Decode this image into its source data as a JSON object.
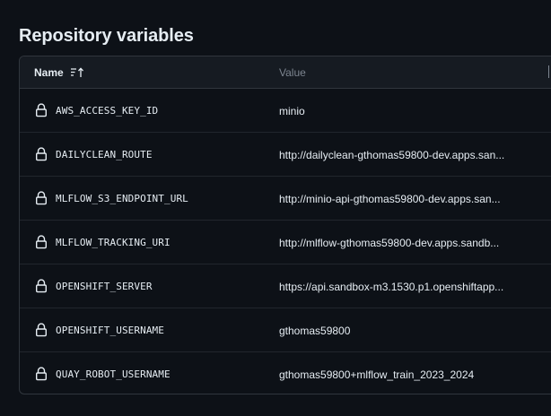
{
  "section": {
    "title": "Repository variables"
  },
  "table": {
    "columns": {
      "name": "Name",
      "value": "Value"
    },
    "sort_icon": "sort-ascending-icon",
    "row_icon": "lock-icon",
    "rows": [
      {
        "name": "AWS_ACCESS_KEY_ID",
        "value": "minio"
      },
      {
        "name": "DAILYCLEAN_ROUTE",
        "value": "http://dailyclean-gthomas59800-dev.apps.san..."
      },
      {
        "name": "MLFLOW_S3_ENDPOINT_URL",
        "value": "http://minio-api-gthomas59800-dev.apps.san..."
      },
      {
        "name": "MLFLOW_TRACKING_URI",
        "value": "http://mlflow-gthomas59800-dev.apps.sandb..."
      },
      {
        "name": "OPENSHIFT_SERVER",
        "value": "https://api.sandbox-m3.1530.p1.openshiftapp..."
      },
      {
        "name": "OPENSHIFT_USERNAME",
        "value": "gthomas59800"
      },
      {
        "name": "QUAY_ROBOT_USERNAME",
        "value": "gthomas59800+mlflow_train_2023_2024"
      }
    ]
  },
  "colors": {
    "background": "#0d1117",
    "header_bg": "#161b22",
    "border": "#30363d",
    "text": "#e6edf3",
    "muted": "#7d8590"
  }
}
